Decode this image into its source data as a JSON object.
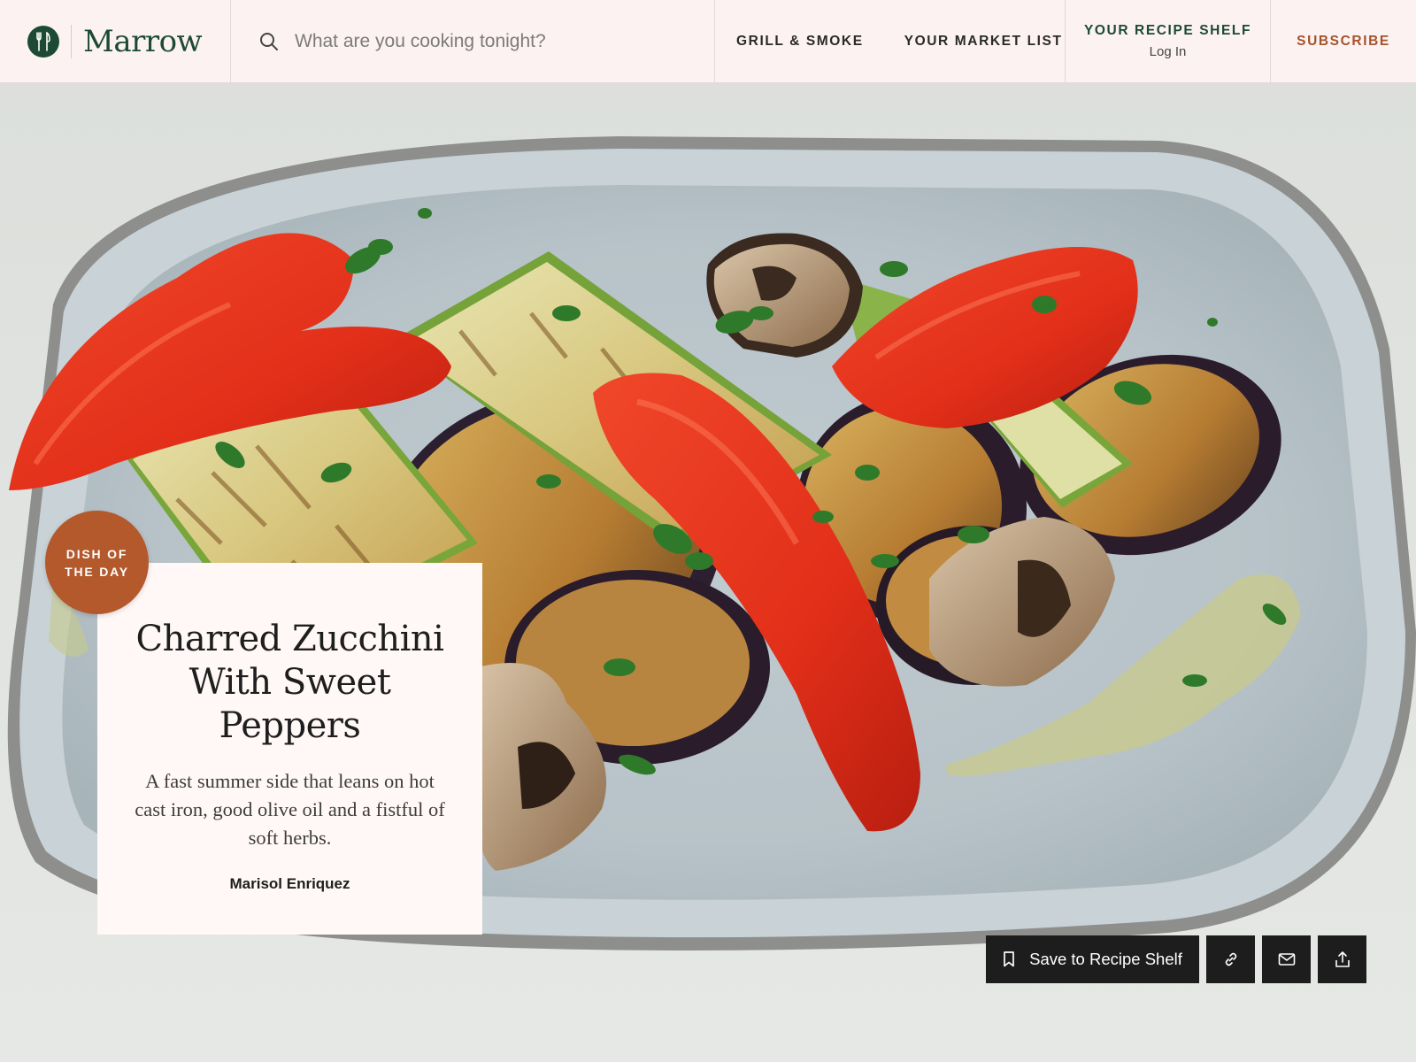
{
  "brand": {
    "name": "Marrow",
    "logo_icon": "fork-knife-icon",
    "logo_color": "#1c4a34"
  },
  "search": {
    "icon": "search-icon",
    "placeholder": "What are you cooking tonight?",
    "value": ""
  },
  "nav": {
    "items": [
      {
        "label": "GRILL & SMOKE"
      },
      {
        "label": "YOUR MARKET LIST"
      }
    ]
  },
  "account": {
    "shelf_label": "YOUR RECIPE SHELF",
    "login_label": "Log In"
  },
  "subscribe": {
    "label": "SUBSCRIBE",
    "color": "#a4542a"
  },
  "hero": {
    "image": "grilled-vegetables-platter",
    "badge": "DISH OF THE DAY",
    "title": "Charred Zucchini With Sweet Peppers",
    "description": "A fast summer side that leans on hot cast iron, good olive oil and a fistful of soft herbs.",
    "author": "Marisol Enriquez"
  },
  "actions": {
    "save_label": "Save to Recipe Shelf",
    "save_icon": "bookmark-icon",
    "buttons": [
      {
        "icon": "link-icon"
      },
      {
        "icon": "mail-icon"
      },
      {
        "icon": "share-icon"
      }
    ]
  },
  "colors": {
    "header_bg": "#fdf2f2",
    "badge_bg": "#b3592c",
    "action_bg": "#1d1d1d"
  }
}
